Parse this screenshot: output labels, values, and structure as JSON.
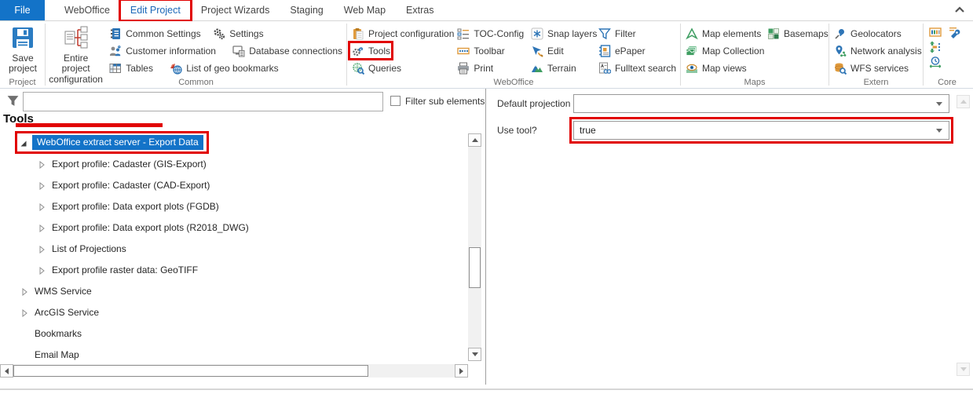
{
  "tabs": {
    "items": [
      {
        "label": "File",
        "active": true
      },
      {
        "label": "WebOffice"
      },
      {
        "label": "Edit Project",
        "annotated": true
      },
      {
        "label": "Project Wizards"
      },
      {
        "label": "Staging"
      },
      {
        "label": "Web Map"
      },
      {
        "label": "Extras"
      }
    ],
    "collapse_icon": "chevron-up-icon"
  },
  "ribbon": {
    "project": {
      "group_label": "Project",
      "save_project": "Save project",
      "save_icon": "floppy-disk-icon"
    },
    "common": {
      "group_label": "Common",
      "entire_project_configuration": "Entire project configuration",
      "common_settings": "Common Settings",
      "settings": "Settings",
      "customer_information": "Customer information",
      "database_connections": "Database connections",
      "tables": "Tables",
      "list_of_geo_bookmarks": "List of geo bookmarks"
    },
    "weboffice": {
      "group_label": "WebOffice",
      "project_configuration": "Project configuration",
      "tools": "Tools",
      "tools_annotated": true,
      "queries": "Queries",
      "toc_config": "TOC-Config",
      "toolbar": "Toolbar",
      "print": "Print",
      "snap_layers": "Snap layers",
      "edit": "Edit",
      "terrain": "Terrain",
      "filter": "Filter",
      "epaper": "ePaper",
      "fulltext_search": "Fulltext search"
    },
    "maps": {
      "group_label": "Maps",
      "map_elements": "Map elements",
      "map_collection": "Map Collection",
      "map_views": "Map views",
      "basemaps": "Basemaps"
    },
    "extern": {
      "group_label": "Extern",
      "geolocators": "Geolocators",
      "network_analysis": "Network analysis",
      "wfs_services": "WFS services"
    },
    "core": {
      "group_label": "Core",
      "icons": [
        "toolbar-window-icon",
        "wrench-config-icon",
        "layer-order-icon",
        "scheduler-clock-icon"
      ]
    }
  },
  "left_panel": {
    "filter_input_value": "",
    "filter_checkbox_label": "Filter sub elements",
    "filter_icon": "funnel-icon",
    "heading": "Tools",
    "tree": [
      {
        "label": "WebOffice extract server - Export Data",
        "level": 0,
        "state": "expanded",
        "selected": true,
        "annotated": true
      },
      {
        "label": "Export profile: Cadaster (GIS-Export)",
        "level": 1,
        "state": "collapsed"
      },
      {
        "label": "Export profile: Cadaster (CAD-Export)",
        "level": 1,
        "state": "collapsed"
      },
      {
        "label": "Export profile: Data export plots (FGDB)",
        "level": 1,
        "state": "collapsed"
      },
      {
        "label": "Export profile: Data export plots (R2018_DWG)",
        "level": 1,
        "state": "collapsed"
      },
      {
        "label": "List of Projections",
        "level": 1,
        "state": "collapsed"
      },
      {
        "label": "Export profile raster data: GeoTIFF",
        "level": 1,
        "state": "collapsed"
      },
      {
        "label": "WMS Service",
        "level": 0,
        "state": "collapsed"
      },
      {
        "label": "ArcGIS Service",
        "level": 0,
        "state": "collapsed"
      },
      {
        "label": "Bookmarks",
        "level": 0,
        "state": "none"
      },
      {
        "label": "Email Map",
        "level": 0,
        "state": "none"
      }
    ]
  },
  "right_panel": {
    "fields": [
      {
        "label": "Default projection",
        "value": ""
      },
      {
        "label": "Use tool?",
        "value": "true",
        "annotated": true
      }
    ]
  },
  "colors": {
    "accent_blue": "#1373c8",
    "selection_blue": "#1373c8",
    "annotation_red": "#e10000",
    "icon_blue": "#2e75b6",
    "icon_green": "#3f9e62",
    "icon_orange": "#e09b3d"
  }
}
